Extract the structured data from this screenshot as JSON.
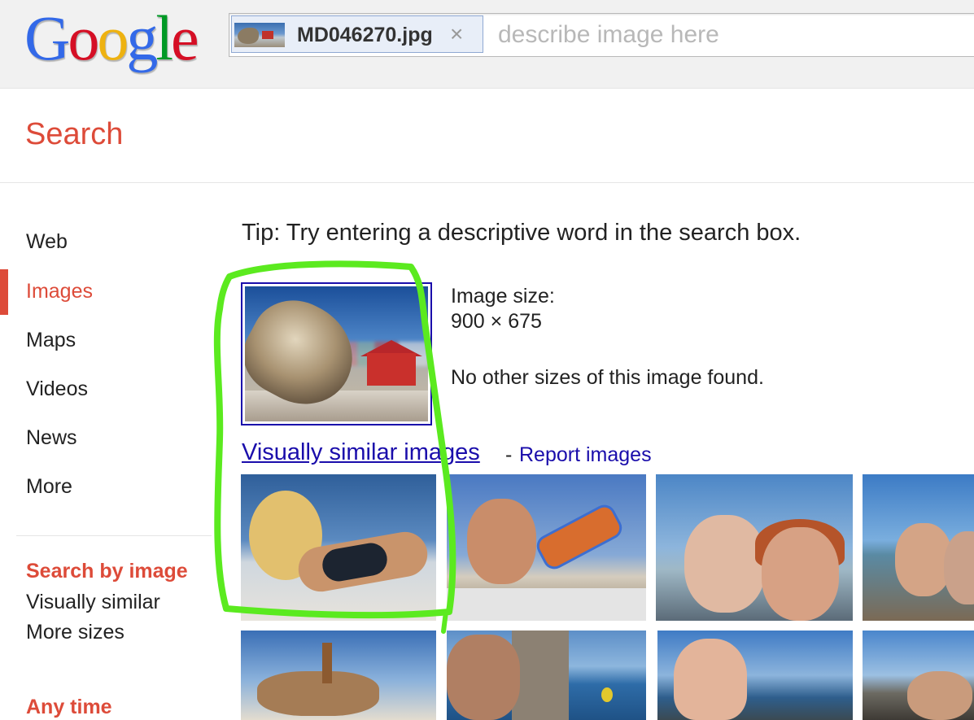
{
  "logo": {
    "letters": [
      "G",
      "o",
      "o",
      "g",
      "l",
      "e"
    ]
  },
  "search": {
    "query_image_name": "MD046270.jpg",
    "remove_glyph": "×",
    "placeholder": "describe image here",
    "value": ""
  },
  "header": {
    "title": "Search"
  },
  "sidebar": {
    "items": [
      {
        "label": "Web"
      },
      {
        "label": "Images",
        "active": true
      },
      {
        "label": "Maps"
      },
      {
        "label": "Videos"
      },
      {
        "label": "News"
      },
      {
        "label": "More"
      }
    ],
    "search_by_image": {
      "heading": "Search by image",
      "links": [
        "Visually similar",
        "More sizes"
      ]
    },
    "time_heading": "Any time"
  },
  "main": {
    "tip": "Tip: Try entering a descriptive word in the search box.",
    "image_size_label": "Image size:",
    "image_size_value": "900 × 675",
    "no_sizes": "No other sizes of this image found.",
    "similar_link": "Visually similar images",
    "separator": "-",
    "report_link": "Report images",
    "result_count": 8
  },
  "colors": {
    "accent": "#dd4b39",
    "link": "#1a0dab",
    "annotation": "#5bea1f",
    "logo": [
      "#3369e8",
      "#d50f25",
      "#eeb211",
      "#3369e8",
      "#009925",
      "#d50f25"
    ]
  }
}
